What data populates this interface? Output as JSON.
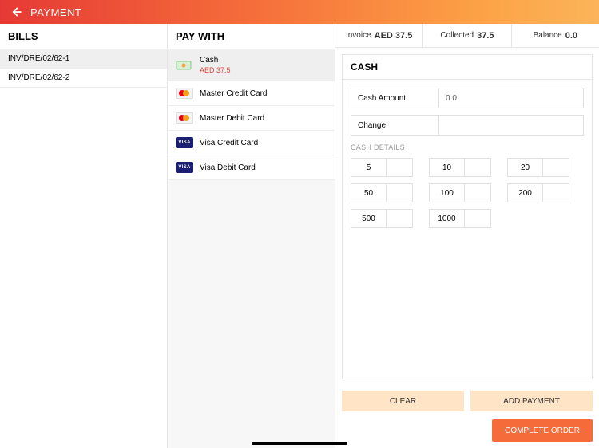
{
  "header": {
    "title": "PAYMENT"
  },
  "bills": {
    "title": "BILLS",
    "items": [
      {
        "label": "INV/DRE/02/62-1",
        "selected": true
      },
      {
        "label": "INV/DRE/02/62-2",
        "selected": false
      }
    ]
  },
  "paywith": {
    "title": "PAY WITH",
    "items": [
      {
        "label": "Cash",
        "sub": "AED 37.5",
        "icon": "cash",
        "selected": true
      },
      {
        "label": "Master Credit Card",
        "icon": "mastercard",
        "selected": false
      },
      {
        "label": "Master Debit Card",
        "icon": "mastercard",
        "selected": false
      },
      {
        "label": "Visa Credit Card",
        "icon": "visa",
        "selected": false
      },
      {
        "label": "Visa Debit Card",
        "icon": "visa",
        "selected": false
      }
    ]
  },
  "summary": {
    "invoice_label": "Invoice",
    "invoice_value": "AED 37.5",
    "collected_label": "Collected",
    "collected_value": "37.5",
    "balance_label": "Balance",
    "balance_value": "0.0"
  },
  "cash": {
    "title": "CASH",
    "amount_label": "Cash Amount",
    "amount_value": "0.0",
    "change_label": "Change",
    "change_value": "",
    "details_label": "CASH DETAILS",
    "denominations": [
      {
        "label": "5",
        "count": ""
      },
      {
        "label": "10",
        "count": ""
      },
      {
        "label": "20",
        "count": ""
      },
      {
        "label": "50",
        "count": ""
      },
      {
        "label": "100",
        "count": ""
      },
      {
        "label": "200",
        "count": ""
      },
      {
        "label": "500",
        "count": ""
      },
      {
        "label": "1000",
        "count": ""
      }
    ]
  },
  "actions": {
    "clear": "CLEAR",
    "add_payment": "ADD PAYMENT",
    "complete": "COMPLETE ORDER"
  },
  "icons": {
    "visa_text": "VISA"
  }
}
